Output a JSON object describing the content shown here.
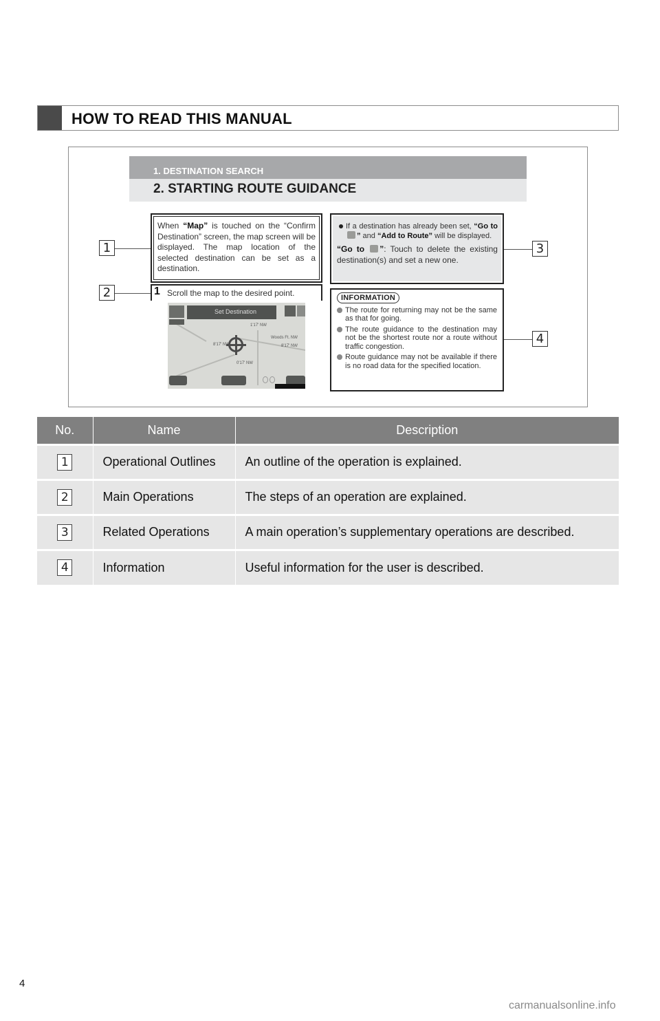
{
  "section_header": {
    "title": "HOW TO READ THIS MANUAL"
  },
  "example": {
    "chapter_title": "1. DESTINATION SEARCH",
    "section_title": "2. STARTING ROUTE GUIDANCE",
    "outline_box": {
      "prefix": "When ",
      "bold": "“Map”",
      "rest": " is touched on the “Confirm Destination” screen, the map screen will be displayed. The map location of the selected destination can be set as a destination."
    },
    "step": {
      "number": "1",
      "text": "Scroll the map to the desired point."
    },
    "screen": {
      "title": "Set Destination",
      "labels": [
        "1'17' NW",
        "Woods Ft. NW",
        "8'17' NW",
        "8'17' NW",
        "0'17' NW"
      ],
      "icons": [
        "menu-icon",
        "crosshair-icon",
        "go-to-button",
        "scale-bar"
      ]
    },
    "related_box": {
      "bullet": {
        "text1": "If a destination has already been set,",
        "bold1": "“Go to ",
        "bold1_end": "”",
        "and": " and ",
        "bold2": "“Add to Route”",
        "text2": " will be displayed."
      },
      "note": {
        "bold": "“Go to ",
        "bold_end": "”",
        "text": ": Touch to delete the existing destination(s) and set a new one."
      }
    },
    "info_box": {
      "tag": "INFORMATION",
      "items": [
        "The route for returning may not be the same as that for going.",
        "The route guidance to the destination may not be the shortest route nor a route without traffic congestion.",
        "Route guidance may not be available if there is no road data for the specified location."
      ]
    },
    "callouts": [
      "1",
      "2",
      "3",
      "4"
    ]
  },
  "table": {
    "headers": [
      "No.",
      "Name",
      "Description"
    ],
    "rows": [
      {
        "no": "1",
        "name": "Operational Outlines",
        "description": "An outline of the operation is explained."
      },
      {
        "no": "2",
        "name": "Main Operations",
        "description": "The steps of an operation are explained."
      },
      {
        "no": "3",
        "name": "Related Operations",
        "description": "A main operation’s supplementary operations are described."
      },
      {
        "no": "4",
        "name": "Information",
        "description": "Useful information for the user is described."
      }
    ]
  },
  "footer": {
    "page_number": "4",
    "watermark": "carmanualsonline.info"
  },
  "colors": {
    "header_block": "#4a4a4a",
    "table_header": "#808080",
    "table_row": "#e6e6e6",
    "chapter_bar": "#a7a8aa",
    "section_bar": "#e6e7e8"
  }
}
